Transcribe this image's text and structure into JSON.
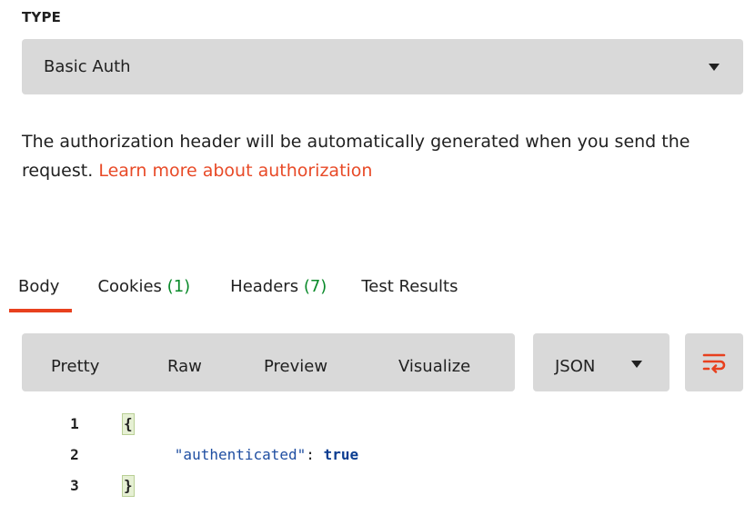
{
  "auth": {
    "type_label": "TYPE",
    "type_value": "Basic Auth",
    "description": "The authorization header will be automatically generated when you send the request.",
    "learn_more_link": "Learn more about authorization"
  },
  "response_tabs": [
    {
      "label": "Body",
      "count": "",
      "active": true
    },
    {
      "label": "Cookies",
      "count": "(1)",
      "active": false
    },
    {
      "label": "Headers",
      "count": "(7)",
      "active": false
    },
    {
      "label": "Test Results",
      "count": "",
      "active": false
    }
  ],
  "view_modes": {
    "pretty": "Pretty",
    "raw": "Raw",
    "preview": "Preview",
    "visualize": "Visualize"
  },
  "format_select": {
    "value": "JSON"
  },
  "wrap_icon": "wrap-lines-icon",
  "code_lines": [
    {
      "number": "1",
      "open": "{"
    },
    {
      "number": "2",
      "key": "\"authenticated\"",
      "colon": ": ",
      "value": "true"
    },
    {
      "number": "3",
      "close": "}"
    }
  ],
  "colors": {
    "accent": "#e8401e",
    "link": "#e84a27",
    "count_green": "#0a8a2a",
    "control_bg": "#d9d9d9",
    "json_key": "#1f4ea1"
  }
}
